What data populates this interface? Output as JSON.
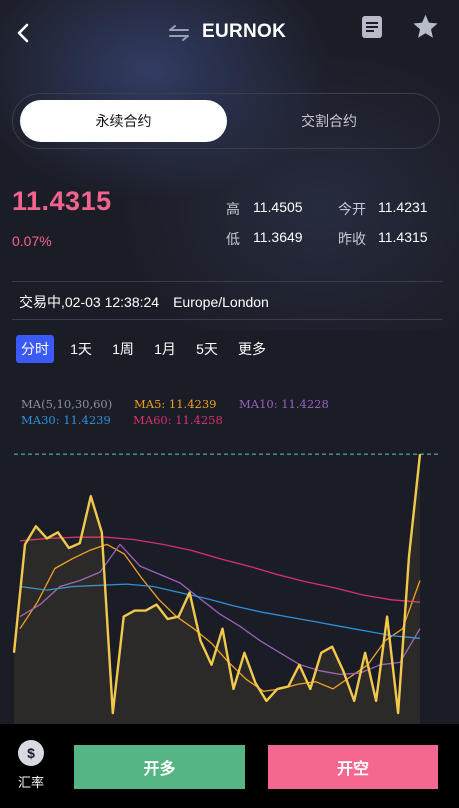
{
  "header": {
    "title": "EURNOK"
  },
  "tabs": [
    {
      "label": "永续合约"
    },
    {
      "label": "交割合约"
    }
  ],
  "quote": {
    "price": "11.4315",
    "change_pct": "0.07%",
    "high_label": "高",
    "high": "11.4505",
    "open_label": "今开",
    "open": "11.4231",
    "low_label": "低",
    "low": "11.3649",
    "prev_close_label": "昨收",
    "prev_close": "11.4315"
  },
  "status": {
    "trading": "交易中,02-03 12:38:24",
    "timezone": "Europe/London"
  },
  "periods": [
    "分时",
    "1天",
    "1周",
    "1月",
    "5天",
    "更多"
  ],
  "ma_legend": {
    "header": "MA(5,10,30,60)",
    "ma5": "MA5: 11.4239",
    "ma10": "MA10: 11.4228",
    "ma30": "MA30: 11.4239",
    "ma60": "MA60: 11.4258"
  },
  "footer": {
    "rate_label": "汇率",
    "rate_symbol": "$",
    "long_label": "开多",
    "short_label": "开空"
  },
  "colors": {
    "accent_up": "#f2638d",
    "period_active": "#3b59f6",
    "ma5": "#f0a020",
    "ma10": "#9b5fc0",
    "ma30": "#2f8fd8",
    "ma60": "#d8306c",
    "price_line": "#f2c94c",
    "long": "#55b585",
    "short": "#f4678f"
  },
  "chart_data": {
    "type": "line",
    "series": [
      {
        "name": "MA5",
        "values": [
          11.417,
          11.4192,
          11.422,
          11.4228,
          11.4235,
          11.424,
          11.4232,
          11.4212,
          11.4194,
          11.418,
          11.417,
          11.4158,
          11.4142,
          11.4128,
          11.4118,
          11.412,
          11.4124,
          11.4126,
          11.412,
          11.413,
          11.414,
          11.416,
          11.417,
          11.421
        ]
      },
      {
        "name": "MA10",
        "values": [
          11.418,
          11.419,
          11.4205,
          11.421,
          11.4217,
          11.424,
          11.4222,
          11.4215,
          11.4208,
          11.4195,
          11.4182,
          11.4172,
          11.416,
          11.415,
          11.414,
          11.4135,
          11.4132,
          11.4133,
          11.414,
          11.4142,
          11.417
        ]
      },
      {
        "name": "MA30",
        "values": [
          11.4205,
          11.4202,
          11.4205,
          11.4206,
          11.4207,
          11.4205,
          11.42,
          11.4195,
          11.4189,
          11.4184,
          11.418,
          11.4176,
          11.4172,
          11.4168,
          11.4164,
          11.4162
        ]
      },
      {
        "name": "MA60",
        "values": [
          11.4243,
          11.4245,
          11.4246,
          11.4246,
          11.4244,
          11.424,
          11.4235,
          11.4228,
          11.4222,
          11.4215,
          11.4209,
          11.4204,
          11.4198,
          11.4194,
          11.4192
        ]
      },
      {
        "name": "Price",
        "values": [
          11.415,
          11.424,
          11.4255,
          11.4245,
          11.425,
          11.4237,
          11.4241,
          11.428,
          11.425,
          11.41,
          11.418,
          11.4185,
          11.4185,
          11.419,
          11.4178,
          11.418,
          11.42,
          11.416,
          11.414,
          11.417,
          11.412,
          11.415,
          11.4125,
          11.411,
          11.412,
          11.4122,
          11.414,
          11.412,
          11.415,
          11.4155,
          11.4135,
          11.411,
          11.415,
          11.411,
          11.418,
          11.41,
          11.423,
          11.4315
        ]
      }
    ],
    "reference_line": 11.4315,
    "ylim": [
      11.409,
      11.4335
    ]
  }
}
